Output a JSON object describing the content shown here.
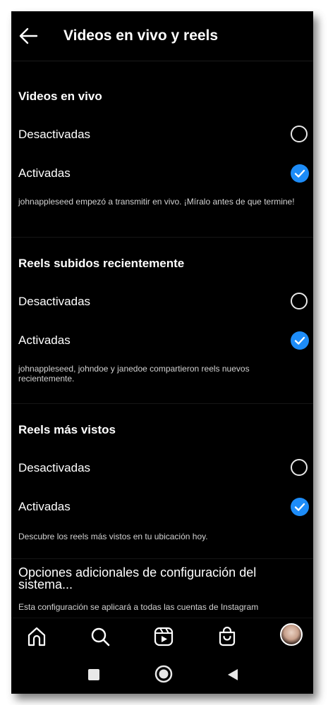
{
  "header": {
    "title": "Videos en vivo y reels"
  },
  "sections": [
    {
      "title": "Videos en vivo",
      "options": [
        {
          "label": "Desactivadas",
          "selected": false
        },
        {
          "label": "Activadas",
          "selected": true
        }
      ],
      "description": "johnappleseed empezó a transmitir en vivo. ¡Míralo antes de que termine!"
    },
    {
      "title": "Reels subidos recientemente",
      "options": [
        {
          "label": "Desactivadas",
          "selected": false
        },
        {
          "label": "Activadas",
          "selected": true
        }
      ],
      "description": "johnappleseed, johndoe y janedoe compartieron reels nuevos recientemente."
    },
    {
      "title": "Reels más vistos",
      "options": [
        {
          "label": "Desactivadas",
          "selected": false
        },
        {
          "label": "Activadas",
          "selected": true
        }
      ],
      "description": "Descubre los reels más vistos en tu ubicación hoy."
    }
  ],
  "extra": {
    "title": "Opciones adicionales de configuración del sistema...",
    "description": "Esta configuración se aplicará a todas las cuentas de Instagram"
  },
  "tabbar": {
    "icons": [
      "home-icon",
      "search-icon",
      "reels-icon",
      "shop-icon",
      "profile-avatar"
    ]
  },
  "navbar": {
    "icons": [
      "recents-square-icon",
      "home-circle-icon",
      "back-triangle-icon"
    ]
  },
  "colors": {
    "accent": "#1d8cf8",
    "background": "#000000",
    "text": "#ffffff"
  }
}
